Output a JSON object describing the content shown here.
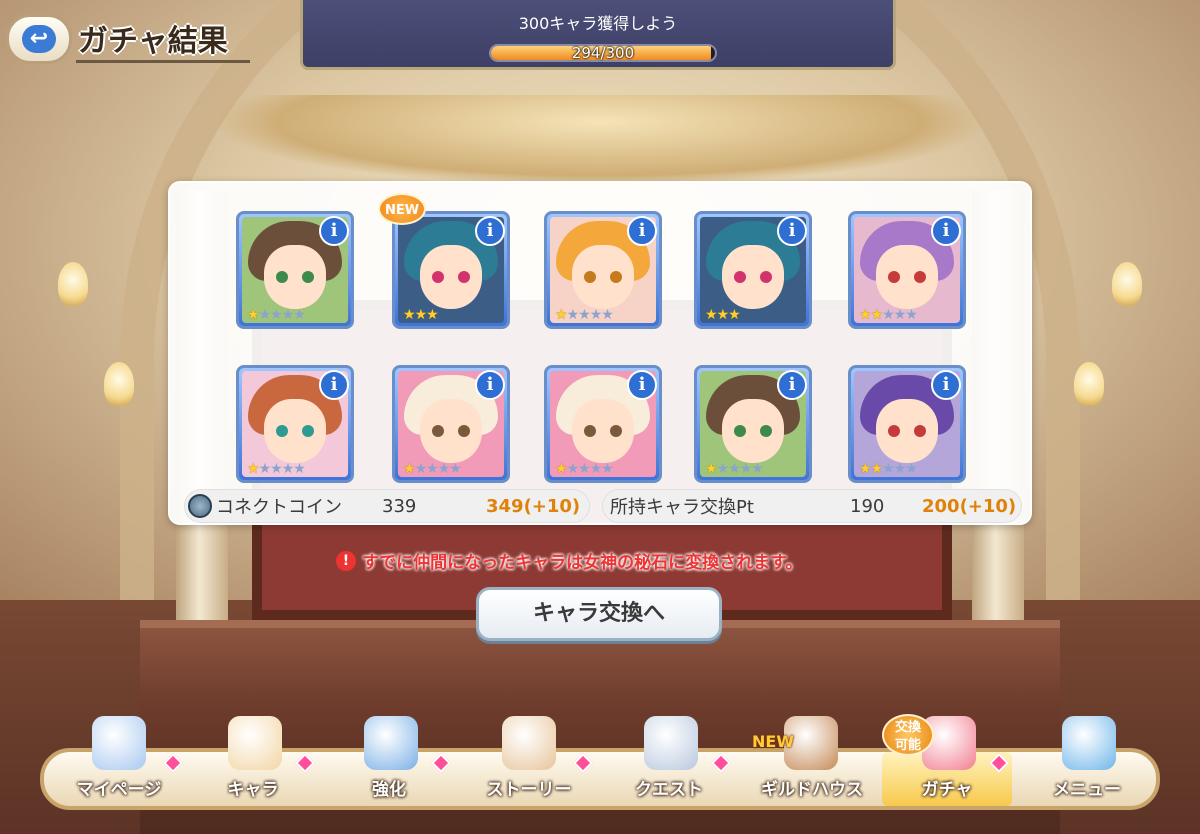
{
  "header": {
    "back_icon": "back-arrow-icon",
    "title": "ガチャ結果"
  },
  "mission": {
    "text": "300キャラ獲得しよう",
    "value": "294/300",
    "progress": 0.98
  },
  "results": {
    "cards": [
      {
        "stars_on": 1,
        "stars_total": 5,
        "new": false,
        "hair": "#6b4f3a",
        "bg": "#9ec57a",
        "eye": "#3e8a4a"
      },
      {
        "stars_on": 3,
        "stars_total": 3,
        "new": true,
        "hair": "#2c7c96",
        "bg": "#3c5e86",
        "eye": "#d2336c"
      },
      {
        "stars_on": 1,
        "stars_total": 5,
        "new": false,
        "hair": "#f4a83c",
        "bg": "#f7d2c6",
        "eye": "#c57a1c"
      },
      {
        "stars_on": 3,
        "stars_total": 3,
        "new": false,
        "hair": "#2c7c96",
        "bg": "#3c5e86",
        "eye": "#d2336c"
      },
      {
        "stars_on": 2,
        "stars_total": 5,
        "new": false,
        "hair": "#a979c9",
        "bg": "#e6b9cf",
        "eye": "#c53a3a"
      },
      {
        "stars_on": 1,
        "stars_total": 5,
        "new": false,
        "hair": "#c9683e",
        "bg": "#f3c8d8",
        "eye": "#2e9a92"
      },
      {
        "stars_on": 1,
        "stars_total": 5,
        "new": false,
        "hair": "#f8eddb",
        "bg": "#f29bb8",
        "eye": "#7a5a3a"
      },
      {
        "stars_on": 1,
        "stars_total": 5,
        "new": false,
        "hair": "#f8eddb",
        "bg": "#f29bb8",
        "eye": "#7a5a3a"
      },
      {
        "stars_on": 1,
        "stars_total": 5,
        "new": false,
        "hair": "#6b4f3a",
        "bg": "#9ec57a",
        "eye": "#3e8a4a"
      },
      {
        "stars_on": 2,
        "stars_total": 5,
        "new": false,
        "hair": "#6a4aa8",
        "bg": "#b4a6d8",
        "eye": "#c53a3a"
      }
    ],
    "new_label": "NEW",
    "info_label": "i"
  },
  "stats": {
    "coin": {
      "label": "コネクトコイン",
      "before": "339",
      "after": "349(+10)"
    },
    "pt": {
      "label": "所持キャラ交換Pt",
      "before": "190",
      "after": "200(+10)"
    }
  },
  "notice": {
    "icon": "!",
    "text": "すでに仲間になったキャラは女神の秘石に変換されます。"
  },
  "exchange_button": {
    "label": "キャラ交換へ"
  },
  "nav": {
    "items": [
      {
        "label": "マイページ",
        "icon": "mypage-castle-icon",
        "color": "#a8c8f0"
      },
      {
        "label": "キャラ",
        "icon": "character-portrait-icon",
        "color": "#f3d5a3"
      },
      {
        "label": "強化",
        "icon": "enhance-orbs-icon",
        "color": "#7ab0e6"
      },
      {
        "label": "ストーリー",
        "icon": "story-scroll-icon",
        "color": "#e8c49a"
      },
      {
        "label": "クエスト",
        "icon": "quest-sword-flag-icon",
        "color": "#b8c8de"
      },
      {
        "label": "ギルドハウス",
        "icon": "guild-house-door-icon",
        "color": "#c48a56"
      },
      {
        "label": "ガチャ",
        "icon": "gacha-capsule-icon",
        "color": "#f27d8f"
      },
      {
        "label": "メニュー",
        "icon": "menu-crystal-icon",
        "color": "#6fb6ea"
      }
    ],
    "new_label": "NEW",
    "exchange_badge": [
      "交換",
      "可能"
    ]
  }
}
